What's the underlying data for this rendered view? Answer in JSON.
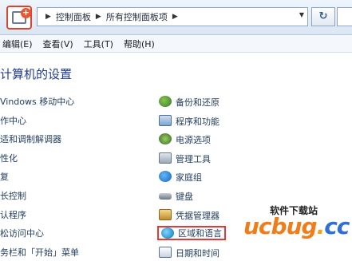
{
  "address": {
    "breadcrumbs": [
      "控制面板",
      "所有控制面板项"
    ]
  },
  "menubar": {
    "items": [
      "编辑(E)",
      "查看(V)",
      "工具(T)",
      "帮助(H)"
    ]
  },
  "page_title": "计算机的设置",
  "left_items": [
    "Vindows 移动中心",
    "作中心",
    "适和调制解调器",
    "性化",
    "复",
    "长控制",
    "认程序",
    "松访问中心",
    "务栏和「开始」菜单"
  ],
  "right_items": [
    {
      "label": "备份和还原",
      "icon": "backup-icon"
    },
    {
      "label": "程序和功能",
      "icon": "programs-icon"
    },
    {
      "label": "电源选项",
      "icon": "power-icon"
    },
    {
      "label": "管理工具",
      "icon": "admin-tools-icon"
    },
    {
      "label": "家庭组",
      "icon": "homegroup-icon"
    },
    {
      "label": "键盘",
      "icon": "keyboard-icon"
    },
    {
      "label": "凭据管理器",
      "icon": "credential-icon"
    },
    {
      "label": "区域和语言",
      "icon": "region-icon"
    },
    {
      "label": "日期和时间",
      "icon": "datetime-icon"
    }
  ],
  "watermark": {
    "site_name": "软件下载站",
    "logo_text": "ucbug",
    "logo_dot": ".",
    "logo_tld": "cc"
  },
  "colors": {
    "title": "#1e3a8a",
    "highlight": "#e53935",
    "logo_orange": "#ef7d1a",
    "logo_blue": "#2e6fd8"
  }
}
